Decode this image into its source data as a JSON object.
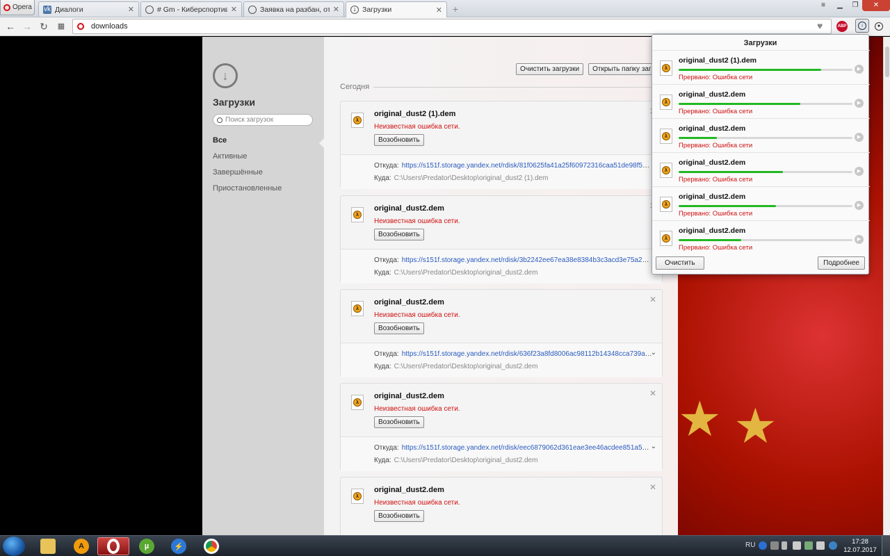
{
  "browser": {
    "menu_label": "Opera",
    "tabs": [
      {
        "title": "Диалоги"
      },
      {
        "title": "# Gm - Киберспортивное"
      },
      {
        "title": "Заявка на разбан, от ВСЕХ"
      },
      {
        "title": "Загрузки"
      }
    ],
    "url": "downloads"
  },
  "sidebar": {
    "title": "Загрузки",
    "search_placeholder": "Поиск загрузок",
    "nav": [
      "Все",
      "Активные",
      "Завершённые",
      "Приостановленные"
    ]
  },
  "main": {
    "clear_button": "Очистить загрузки",
    "open_folder_button": "Открыть папку загрузок",
    "day_label": "Сегодня",
    "from_label": "Откуда:",
    "to_label": "Куда:",
    "resume_label": "Возобновить",
    "items": [
      {
        "name": "original_dust2 (1).dem",
        "error": "Неизвестная ошибка сети.",
        "from": "https://s151f.storage.yandex.net/rdisk/81f0625fa41a25f60972316caa51de98f5437c133...",
        "to": "C:\\Users\\Predator\\Desktop\\original_dust2 (1).dem"
      },
      {
        "name": "original_dust2.dem",
        "error": "Неизвестная ошибка сети.",
        "from": "https://s151f.storage.yandex.net/rdisk/3b2242ee67ea38e8384b3c3acd3e75a2e72ce25b...",
        "to": "C:\\Users\\Predator\\Desktop\\original_dust2.dem"
      },
      {
        "name": "original_dust2.dem",
        "error": "Неизвестная ошибка сети.",
        "from": "https://s151f.storage.yandex.net/rdisk/636f23a8fd8006ac98112b14348cca739a0fc959f...",
        "to": "C:\\Users\\Predator\\Desktop\\original_dust2.dem"
      },
      {
        "name": "original_dust2.dem",
        "error": "Неизвестная ошибка сети.",
        "from": "https://s151f.storage.yandex.net/rdisk/eec6879062d361eae3ee46acdee851a56e95d4ba...",
        "to": "C:\\Users\\Predator\\Desktop\\original_dust2.dem"
      },
      {
        "name": "original_dust2.dem",
        "error": "Неизвестная ошибка сети.",
        "from": "",
        "to": ""
      }
    ]
  },
  "popup": {
    "title": "Загрузки",
    "clear_button": "Очистить",
    "more_button": "Подробнее",
    "items": [
      {
        "name": "original_dust2 (1).dem",
        "status": "Прервано: Ошибка сети",
        "progress": 0.82
      },
      {
        "name": "original_dust2.dem",
        "status": "Прервано: Ошибка сети",
        "progress": 0.7
      },
      {
        "name": "original_dust2.dem",
        "status": "Прервано: Ошибка сети",
        "progress": 0.22
      },
      {
        "name": "original_dust2.dem",
        "status": "Прервано: Ошибка сети",
        "progress": 0.6
      },
      {
        "name": "original_dust2.dem",
        "status": "Прервано: Ошибка сети",
        "progress": 0.56
      },
      {
        "name": "original_dust2.dem",
        "status": "Прервано: Ошибка сети",
        "progress": 0.36
      }
    ]
  },
  "taskbar": {
    "language": "RU",
    "time": "17:28",
    "date": "12.07.2017"
  },
  "colors": {
    "progress": "#22b822",
    "error_text": "#d01010",
    "link": "#2a5bbd",
    "opera_red": "#d60d12"
  }
}
